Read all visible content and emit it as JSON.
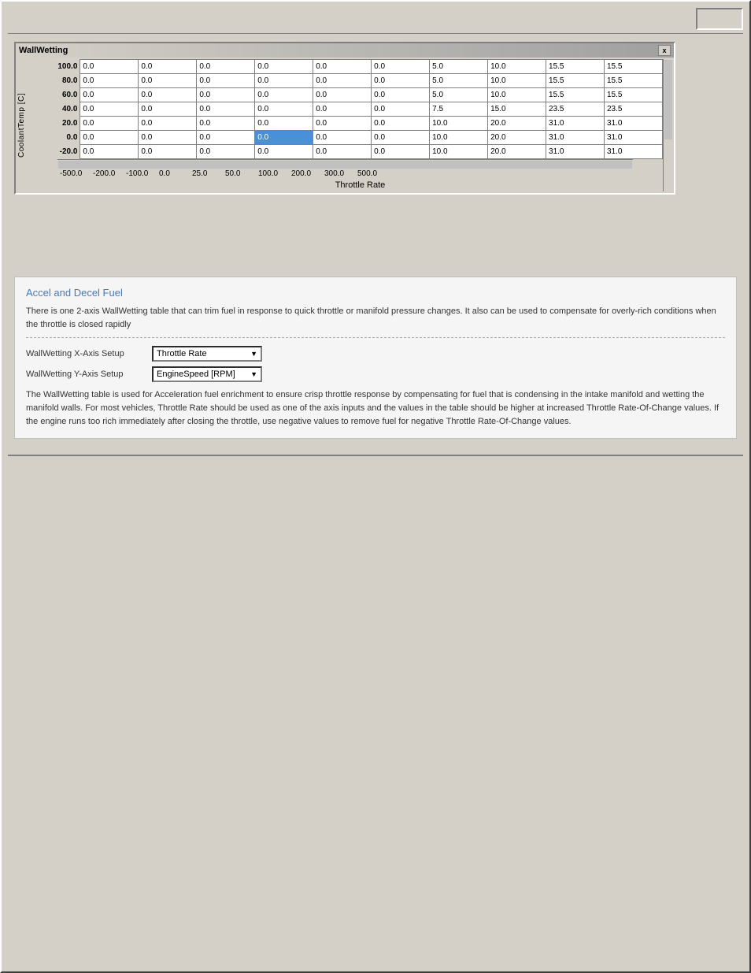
{
  "window": {
    "title": "WallWetting",
    "close_label": "x"
  },
  "table": {
    "y_axis_title": "CoolantTemp [C]",
    "x_axis_label": "Throttle Rate",
    "y_values": [
      "100.0",
      "80.0",
      "60.0",
      "40.0",
      "20.0",
      "0.0",
      "-20.0"
    ],
    "x_values": [
      "-500.0",
      "-200.0",
      "-100.0",
      "0.0",
      "25.0",
      "50.0",
      "100.0",
      "200.0",
      "300.0",
      "500.0"
    ],
    "rows": [
      [
        "0.0",
        "0.0",
        "0.0",
        "0.0",
        "0.0",
        "0.0",
        "5.0",
        "10.0",
        "15.5",
        "15.5"
      ],
      [
        "0.0",
        "0.0",
        "0.0",
        "0.0",
        "0.0",
        "0.0",
        "5.0",
        "10.0",
        "15.5",
        "15.5"
      ],
      [
        "0.0",
        "0.0",
        "0.0",
        "0.0",
        "0.0",
        "0.0",
        "5.0",
        "10.0",
        "15.5",
        "15.5"
      ],
      [
        "0.0",
        "0.0",
        "0.0",
        "0.0",
        "0.0",
        "0.0",
        "7.5",
        "15.0",
        "23.5",
        "23.5"
      ],
      [
        "0.0",
        "0.0",
        "0.0",
        "0.0",
        "0.0",
        "0.0",
        "10.0",
        "20.0",
        "31.0",
        "31.0"
      ],
      [
        "0.0",
        "0.0",
        "0.0",
        "0.0",
        "0.0",
        "0.0",
        "10.0",
        "20.0",
        "31.0",
        "31.0"
      ],
      [
        "0.0",
        "0.0",
        "0.0",
        "0.0",
        "0.0",
        "0.0",
        "10.0",
        "20.0",
        "31.0",
        "31.0"
      ]
    ],
    "highlighted_cell": {
      "row": 5,
      "col": 3
    }
  },
  "info_panel": {
    "title": "Accel and Decel Fuel",
    "description": "There is one 2-axis WallWetting table that can trim fuel in response to quick throttle or manifold pressure changes. It also can be used to compensate for overly-rich conditions when the throttle is closed rapidly",
    "x_axis_setup_label": "WallWetting X-Axis Setup",
    "x_axis_setup_value": "Throttle Rate",
    "y_axis_setup_label": "WallWetting Y-Axis Setup",
    "y_axis_setup_value": "EngineSpeed [RPM]",
    "body_text": "The WallWetting table is used for Acceleration fuel enrichment to ensure crisp throttle response by compensating for fuel that is condensing in the intake manifold and wetting the manifold walls. For most vehicles, Throttle Rate should be used as one of the axis inputs and the values in the table should be higher at increased Throttle Rate-Of-Change values. If the engine runs too rich immediately after closing the throttle, use negative values to remove fuel for negative Throttle Rate-Of-Change values."
  }
}
